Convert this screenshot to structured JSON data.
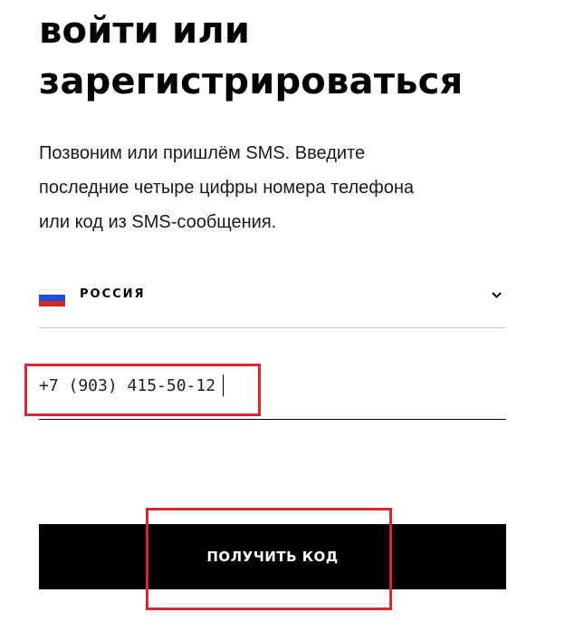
{
  "heading": {
    "line1": "войти или",
    "line2": "зарегистрироваться"
  },
  "description": {
    "line1": "Позвоним или пришлём SMS. Введите",
    "line2": "последние четыре цифры номера телефона",
    "line3": "или код из SMS-сообщения."
  },
  "country_select": {
    "flag_icon": "russia-flag-icon",
    "label": "РОССИЯ",
    "chevron_icon": "chevron-down-icon",
    "flag_colors": [
      "#ffffff",
      "#1f4fd8",
      "#d52b1e"
    ]
  },
  "phone": {
    "value": "+7 (903) 415-50-12"
  },
  "submit": {
    "label": "ПОЛУЧИТЬ КОД"
  },
  "colors": {
    "accent": "#000000",
    "highlight": "#d7282f",
    "divider": "#cccccc"
  }
}
